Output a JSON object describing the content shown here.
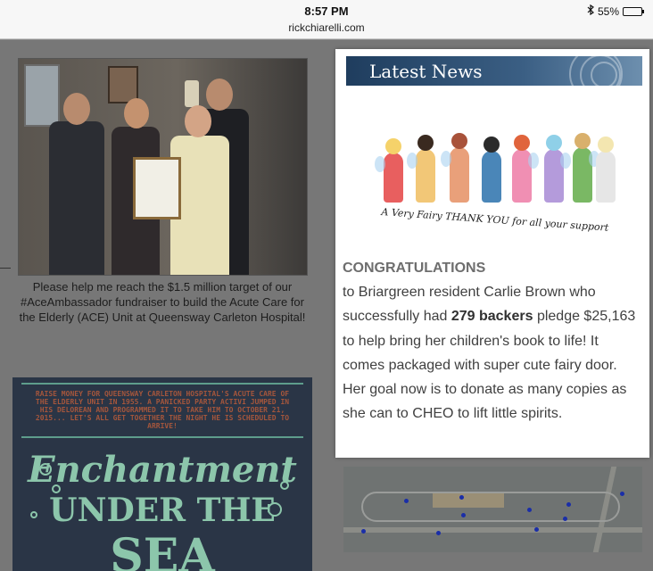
{
  "status_bar": {
    "time": "8:57 PM",
    "url": "rickchiarelli.com",
    "bluetooth_icon": "bluetooth-icon",
    "battery_text": "55%",
    "battery_level": 0.55
  },
  "left_column": {
    "photo_caption": "Please help me reach the $1.5 million target of our #AceAmbassador fundraiser to build the Acute Care for the Elderly (ACE) Unit at Queensway Carleton Hospital!",
    "poster_small_text": "RAISE MONEY FOR QUEENSWAY CARLETON HOSPITAL'S ACUTE CARE OF THE ELDERLY UNIT IN 1955. A PANICKED PARTY ACTIVI JUMPED IN HIS DELOREAN AND PROGRAMMED IT TO TAKE HIM TO OCTOBER 21, 2015... LET'S ALL GET TOGETHER THE NIGHT HE IS SCHEDULED TO ARRIVE!",
    "poster_title_line1": "Enchantment",
    "poster_title_line2": "UNDER THE",
    "poster_title_line3": "SEA"
  },
  "news": {
    "header": "Latest News",
    "image_caption": "A Very Fairy THANK YOU for all your support",
    "congrats_heading": "CONGRATULATIONS",
    "text_1": "to Briargreen resident Carlie Brown who successfully had",
    "backers_bold": "279 backers",
    "text_2": "pledge $25,163 to help bring her children's book to life! It comes packaged with super cute fairy door. Her goal now is to donate as many copies as she can to CHEO to lift little spirits."
  },
  "colors": {
    "news_header_dark": "#1f3d5e",
    "poster_background": "#2a3546",
    "poster_title": "#8cc6ab",
    "map_markers": "#1a2ea8"
  }
}
